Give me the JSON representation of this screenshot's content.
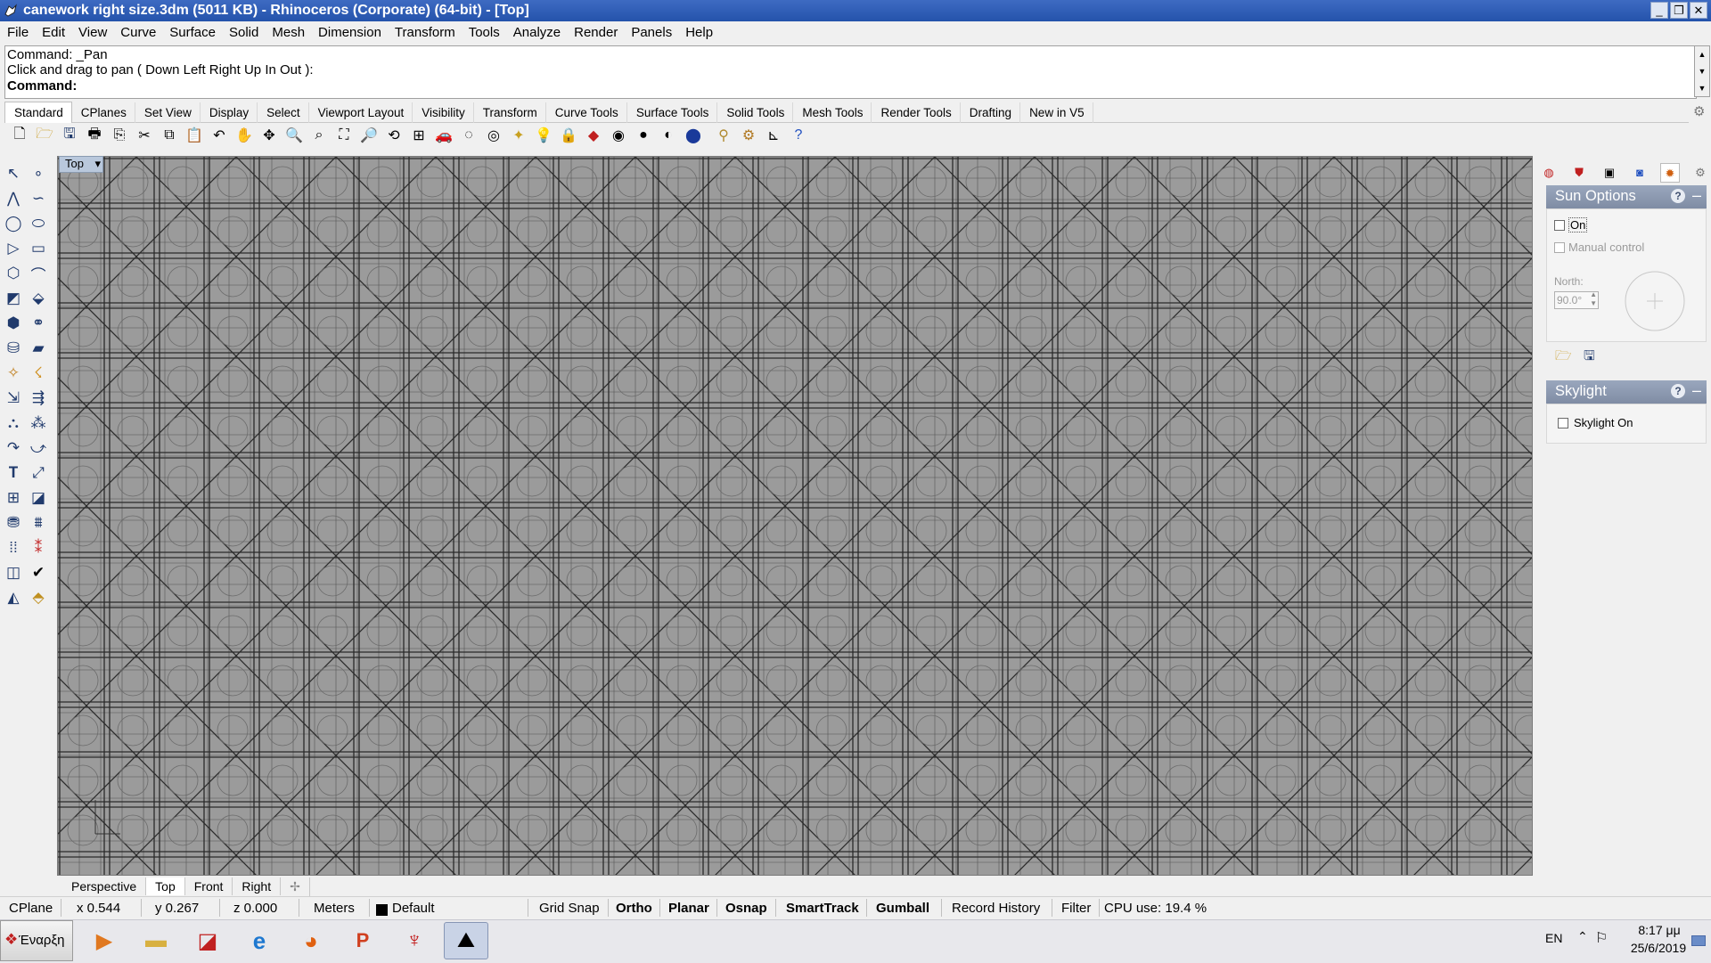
{
  "window": {
    "title": "canework right size.3dm (5011 KB) - Rhinoceros (Corporate) (64-bit) - [Top]",
    "controls": [
      "minimize",
      "restore",
      "close"
    ]
  },
  "menu": [
    "File",
    "Edit",
    "View",
    "Curve",
    "Surface",
    "Solid",
    "Mesh",
    "Dimension",
    "Transform",
    "Tools",
    "Analyze",
    "Render",
    "Panels",
    "Help"
  ],
  "command": {
    "history_line1": "Command: _Pan",
    "history_line2": "Click and drag to pan ( Down  Left  Right  Up  In  Out ):",
    "prompt": "Command:"
  },
  "toolbar_tabs": [
    "Standard",
    "CPlanes",
    "Set View",
    "Display",
    "Select",
    "Viewport Layout",
    "Visibility",
    "Transform",
    "Curve Tools",
    "Surface Tools",
    "Solid Tools",
    "Mesh Tools",
    "Render Tools",
    "Drafting",
    "New in V5"
  ],
  "active_toolbar_tab": "Standard",
  "standard_toolbar_icons": [
    "new-icon",
    "open-icon",
    "save-icon",
    "print-icon",
    "export-icon",
    "cut-icon",
    "copy-icon",
    "paste-icon",
    "undo-icon",
    "pan-icon",
    "rotate-view-icon",
    "zoom-icon",
    "zoom-window-icon",
    "zoom-extents-icon",
    "zoom-selected-icon",
    "rotate-icon",
    "four-viewports-icon",
    "car-icon",
    "hide-icon",
    "show-icon",
    "light-icon",
    "lock-icon",
    "layer-icon",
    "color-wheel-icon",
    "shaded-icon",
    "rendered-icon",
    "render-sphere-icon",
    "filter-icon",
    "settings-gear-icon",
    "dimension-icon",
    "help-icon"
  ],
  "left_toolbar_icons": [
    "select-arrow-icon",
    "point-icon",
    "polyline-icon",
    "curve-icon",
    "circle-icon",
    "ellipse-icon",
    "arc-icon",
    "rectangle-icon",
    "polygon-icon",
    "fillet-icon",
    "surface-icon",
    "extrude-icon",
    "box-icon",
    "boolean-icon",
    "cylinder-icon",
    "mesh-icon",
    "transform-icon",
    "light-icon",
    "move-icon",
    "rotate-icon",
    "group-icon",
    "array-icon",
    "join-icon",
    "explode-icon",
    "text-icon",
    "dimension-icon",
    "block-icon",
    "analyze-icon",
    "render-icon",
    "layer-icon",
    "grid-icon",
    "point-cloud-icon",
    "paint-icon",
    "check-icon",
    "material-icon",
    "environment-icon"
  ],
  "viewport": {
    "label": "Top",
    "menu_arrow": "▾",
    "tabs": [
      "Perspective",
      "Top",
      "Front",
      "Right"
    ],
    "active_tab": "Top",
    "add_tab_icon": "plus-icon",
    "background_color": "#9b9b9b",
    "grid_color": "#555555",
    "pattern_line_color": "#2a2a2a"
  },
  "right_panel": {
    "tab_icons": [
      "color-wheel-icon",
      "materials-icon",
      "display-icon",
      "environment-icon",
      "sun-icon",
      "panel-gear-icon"
    ],
    "sun_options": {
      "title": "Sun Options",
      "on_label": "On",
      "on_checked": false,
      "manual_control_label": "Manual control",
      "manual_control_checked": false,
      "north_label": "North:",
      "north_value": "90.0°"
    },
    "skylight": {
      "title": "Skylight",
      "skylight_on_label": "Skylight On",
      "skylight_on_checked": false
    }
  },
  "status": {
    "cplane": "CPlane",
    "x": "x 0.544",
    "y": "y 0.267",
    "z": "z 0.000",
    "units": "Meters",
    "layer": "Default",
    "grid_snap": "Grid Snap",
    "ortho": "Ortho",
    "planar": "Planar",
    "osnap": "Osnap",
    "smarttrack": "SmartTrack",
    "gumball": "Gumball",
    "record_history": "Record History",
    "filter": "Filter",
    "cpu": "CPU use: 19.4 %"
  },
  "taskbar": {
    "start_label": "Έναρξη",
    "apps": [
      "media-player-icon",
      "file-explorer-icon",
      "image-viewer-icon",
      "internet-explorer-icon",
      "firefox-icon",
      "powerpoint-icon",
      "acrobat-icon",
      "rhino-icon"
    ],
    "active_app": "rhino-icon",
    "language": "EN",
    "time": "8:17 μμ",
    "date": "25/6/2019"
  }
}
